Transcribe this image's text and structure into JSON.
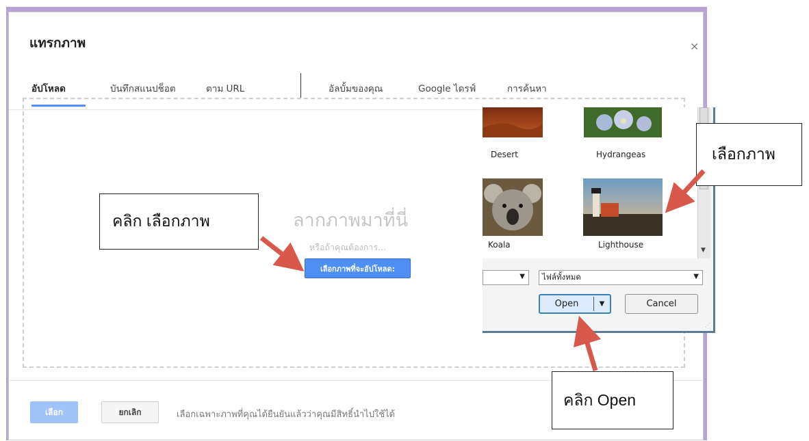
{
  "dialog": {
    "title": "แทรกภาพ",
    "close_icon": "×"
  },
  "tabs": [
    {
      "label": "อัปโหลด",
      "active": true
    },
    {
      "label": "บันทึกสแนปช็อต",
      "active": false
    },
    {
      "label": "ตาม URL",
      "active": false
    },
    {
      "label": "อัลบั้มของคุณ",
      "active": false
    },
    {
      "label": "Google ไดรฟ์",
      "active": false
    },
    {
      "label": "การค้นหา",
      "active": false
    }
  ],
  "upload": {
    "drag_text": "ลากภาพมาที่นี่",
    "or_text": "หรือถ้าคุณต้องการ...",
    "choose_button": "เลือกภาพที่จะอัปโหลด:"
  },
  "footer": {
    "select_button": "เลือก",
    "cancel_button": "ยกเลิก",
    "note": "เลือกเฉพาะภาพที่คุณได้ยืนยันแล้วว่าคุณมีสิทธิ์นำไปใช้ได้"
  },
  "file_dialog": {
    "items": [
      {
        "label": "Desert",
        "icon": "desert-thumbnail"
      },
      {
        "label": "Hydrangeas",
        "icon": "hydrangeas-thumbnail"
      },
      {
        "label": "Koala",
        "icon": "koala-thumbnail"
      },
      {
        "label": "Lighthouse",
        "icon": "lighthouse-thumbnail"
      }
    ],
    "file_type": "ไฟล์ทั้งหมด",
    "open_button": "Open",
    "cancel_button": "Cancel"
  },
  "annotations": {
    "click_choose": "คลิก เลือกภาพ",
    "choose_image": "เลือกภาพ",
    "click_open": "คลิก Open",
    "arrow_color": "#d9584c"
  },
  "colors": {
    "accent_blue": "#4d90fe",
    "frame_purple": "#b9a3d6"
  }
}
